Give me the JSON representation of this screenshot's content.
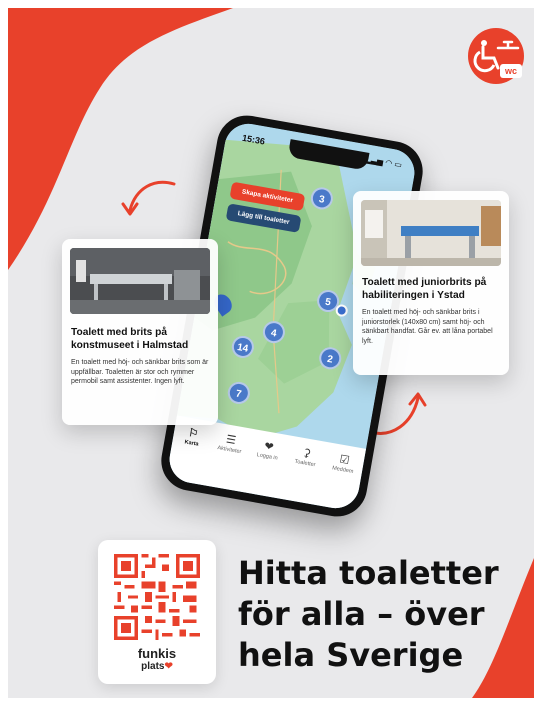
{
  "status_bar": {
    "time": "15:36",
    "icons": "▂▃▅ ◠ ▭"
  },
  "map": {
    "buttons": {
      "create_activity": "Skapa aktiviteter",
      "add_toilet": "Lägg till toaletter"
    },
    "clusters": [
      "3",
      "5",
      "4",
      "14",
      "2",
      "7"
    ]
  },
  "tabbar": [
    {
      "label": "Karta",
      "icon": "map-icon"
    },
    {
      "label": "Aktiviteter",
      "icon": "list-icon"
    },
    {
      "label": "Logga in",
      "icon": "heart-logo-icon"
    },
    {
      "label": "Toaletter",
      "icon": "toilet-icon"
    },
    {
      "label": "Meddem",
      "icon": "membership-icon"
    }
  ],
  "card_left": {
    "title": "Toalett med brits på konstmuseet i Halmstad",
    "body": "En toalett med höj- och sänkbar brits som är uppfällbar. Toaletten är stor och rymmer permobil samt assistenter. Ingen lyft."
  },
  "card_right": {
    "title": "Toalett med juniorbrits på habiliteringen i Ystad",
    "body": "En toalett med höj- och sänkbar brits i juniorstorlek (140x80 cm) samt höj- och sänkbart handfat. Går ev. att låna portabel lyft."
  },
  "badge": {
    "text": "wc",
    "icon": "wheelchair-wc-icon"
  },
  "qr": {
    "brand_line1": "funkis",
    "brand_line2": "plats"
  },
  "headline": [
    "Hitta toaletter",
    "för alla – över",
    "hela Sverige"
  ],
  "colors": {
    "accent": "#e8412b",
    "navy": "#264a73",
    "pin": "#4a79c9",
    "background": "#e9e9eb"
  }
}
